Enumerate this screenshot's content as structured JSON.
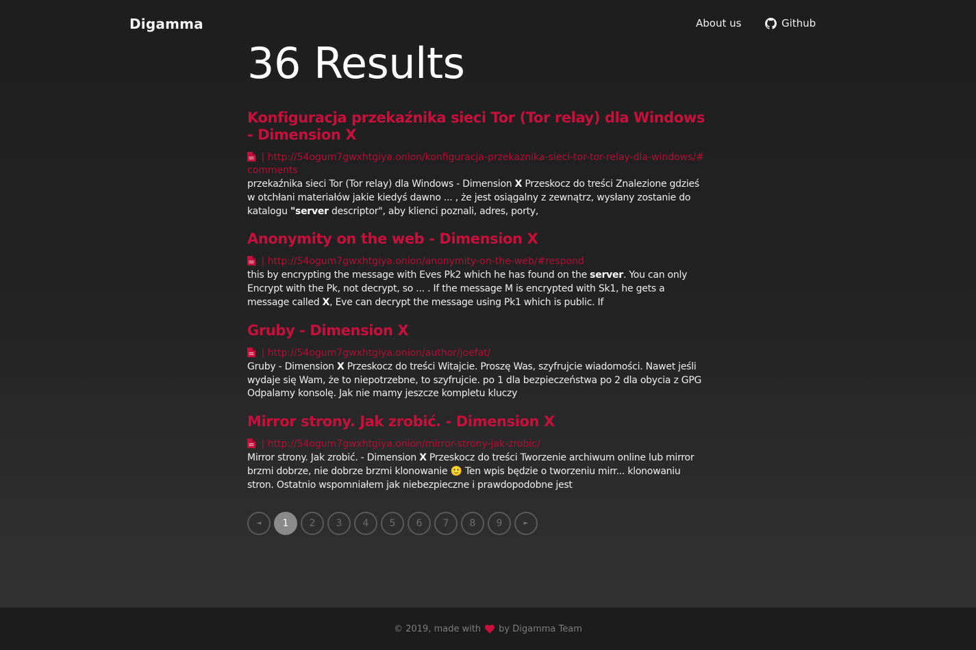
{
  "nav": {
    "brand": "Digamma",
    "about": "About us",
    "github": "Github"
  },
  "colors": {
    "accent": "#c8103c",
    "background": "#232323",
    "footer": "#1c1c1c"
  },
  "results_title": "36 Results",
  "results": [
    {
      "title": "Konfiguracja przekaźnika sieci Tor (Tor relay) dla Windows - Dimension X",
      "url": "http://54ogum7gwxhtgiya.onion/konfiguracja-przekaznika-sieci-tor-tor-relay-dla-windows/#comments",
      "snippet": [
        {
          "t": "przekaźnika sieci Tor (Tor relay) dla Windows - Dimension "
        },
        {
          "t": "X",
          "b": true
        },
        {
          "t": " Przeskocz do treści Znalezione gdzieś w otchłani materiałów jakie kiedyś dawno ... , że jest osiągalny z zewnątrz, wysłany zostanie do katalogu "
        },
        {
          "t": "\"server",
          "b": true
        },
        {
          "t": " descriptor\", aby klienci poznali, adres, porty,"
        }
      ]
    },
    {
      "title": "Anonymity on the web - Dimension X",
      "url": "http://54ogum7gwxhtgiya.onion/anonymity-on-the-web/#respond",
      "snippet": [
        {
          "t": "this by encrypting the message with Eves Pk2 which he has found on the "
        },
        {
          "t": "server",
          "b": true
        },
        {
          "t": ". You can only Encrypt with the Pk, not decrypt, so ... . If the message M is encrypted with Sk1, he gets a message called "
        },
        {
          "t": "X",
          "b": true
        },
        {
          "t": ", Eve can decrypt the message using Pk1 which is public. If"
        }
      ]
    },
    {
      "title": "Gruby - Dimension X",
      "url": "http://54ogum7gwxhtgiya.onion/author/joefat/",
      "snippet": [
        {
          "t": "Gruby - Dimension "
        },
        {
          "t": "X",
          "b": true
        },
        {
          "t": " Przeskocz do treści Witajcie. Proszę Was, szyfrujcie wiadomości. Nawet jeśli wydaje się Wam, że to niepotrzebne, to szyfrujcie. po 1 dla bezpieczeństwa po 2 dla obycia z GPG Odpalamy konsolę. Jak nie mamy jeszcze kompletu kluczy"
        }
      ]
    },
    {
      "title": "Mirror strony. Jak zrobić. - Dimension X",
      "url": "http://54ogum7gwxhtgiya.onion/mirror-strony-jak-zrobic/",
      "snippet": [
        {
          "t": "Mirror strony. Jak zrobić. - Dimension "
        },
        {
          "t": "X",
          "b": true
        },
        {
          "t": " Przeskocz do treści Tworzenie archiwum online lub mirror brzmi dobrze, nie dobrze brzmi klonowanie 🙂 Ten wpis będzie o tworzeniu mirr... klonowaniu stron. Ostatnio wspomniałem jak niebezpieczne i prawdopodobne jest"
        }
      ]
    }
  ],
  "pagination": {
    "prev": "◄",
    "next": "►",
    "pages": [
      "1",
      "2",
      "3",
      "4",
      "5",
      "6",
      "7",
      "8",
      "9"
    ],
    "current": "1"
  },
  "footer": {
    "prefix": "© 2019, made with",
    "suffix": "by Digamma Team",
    "heart_icon": "heart-icon"
  }
}
